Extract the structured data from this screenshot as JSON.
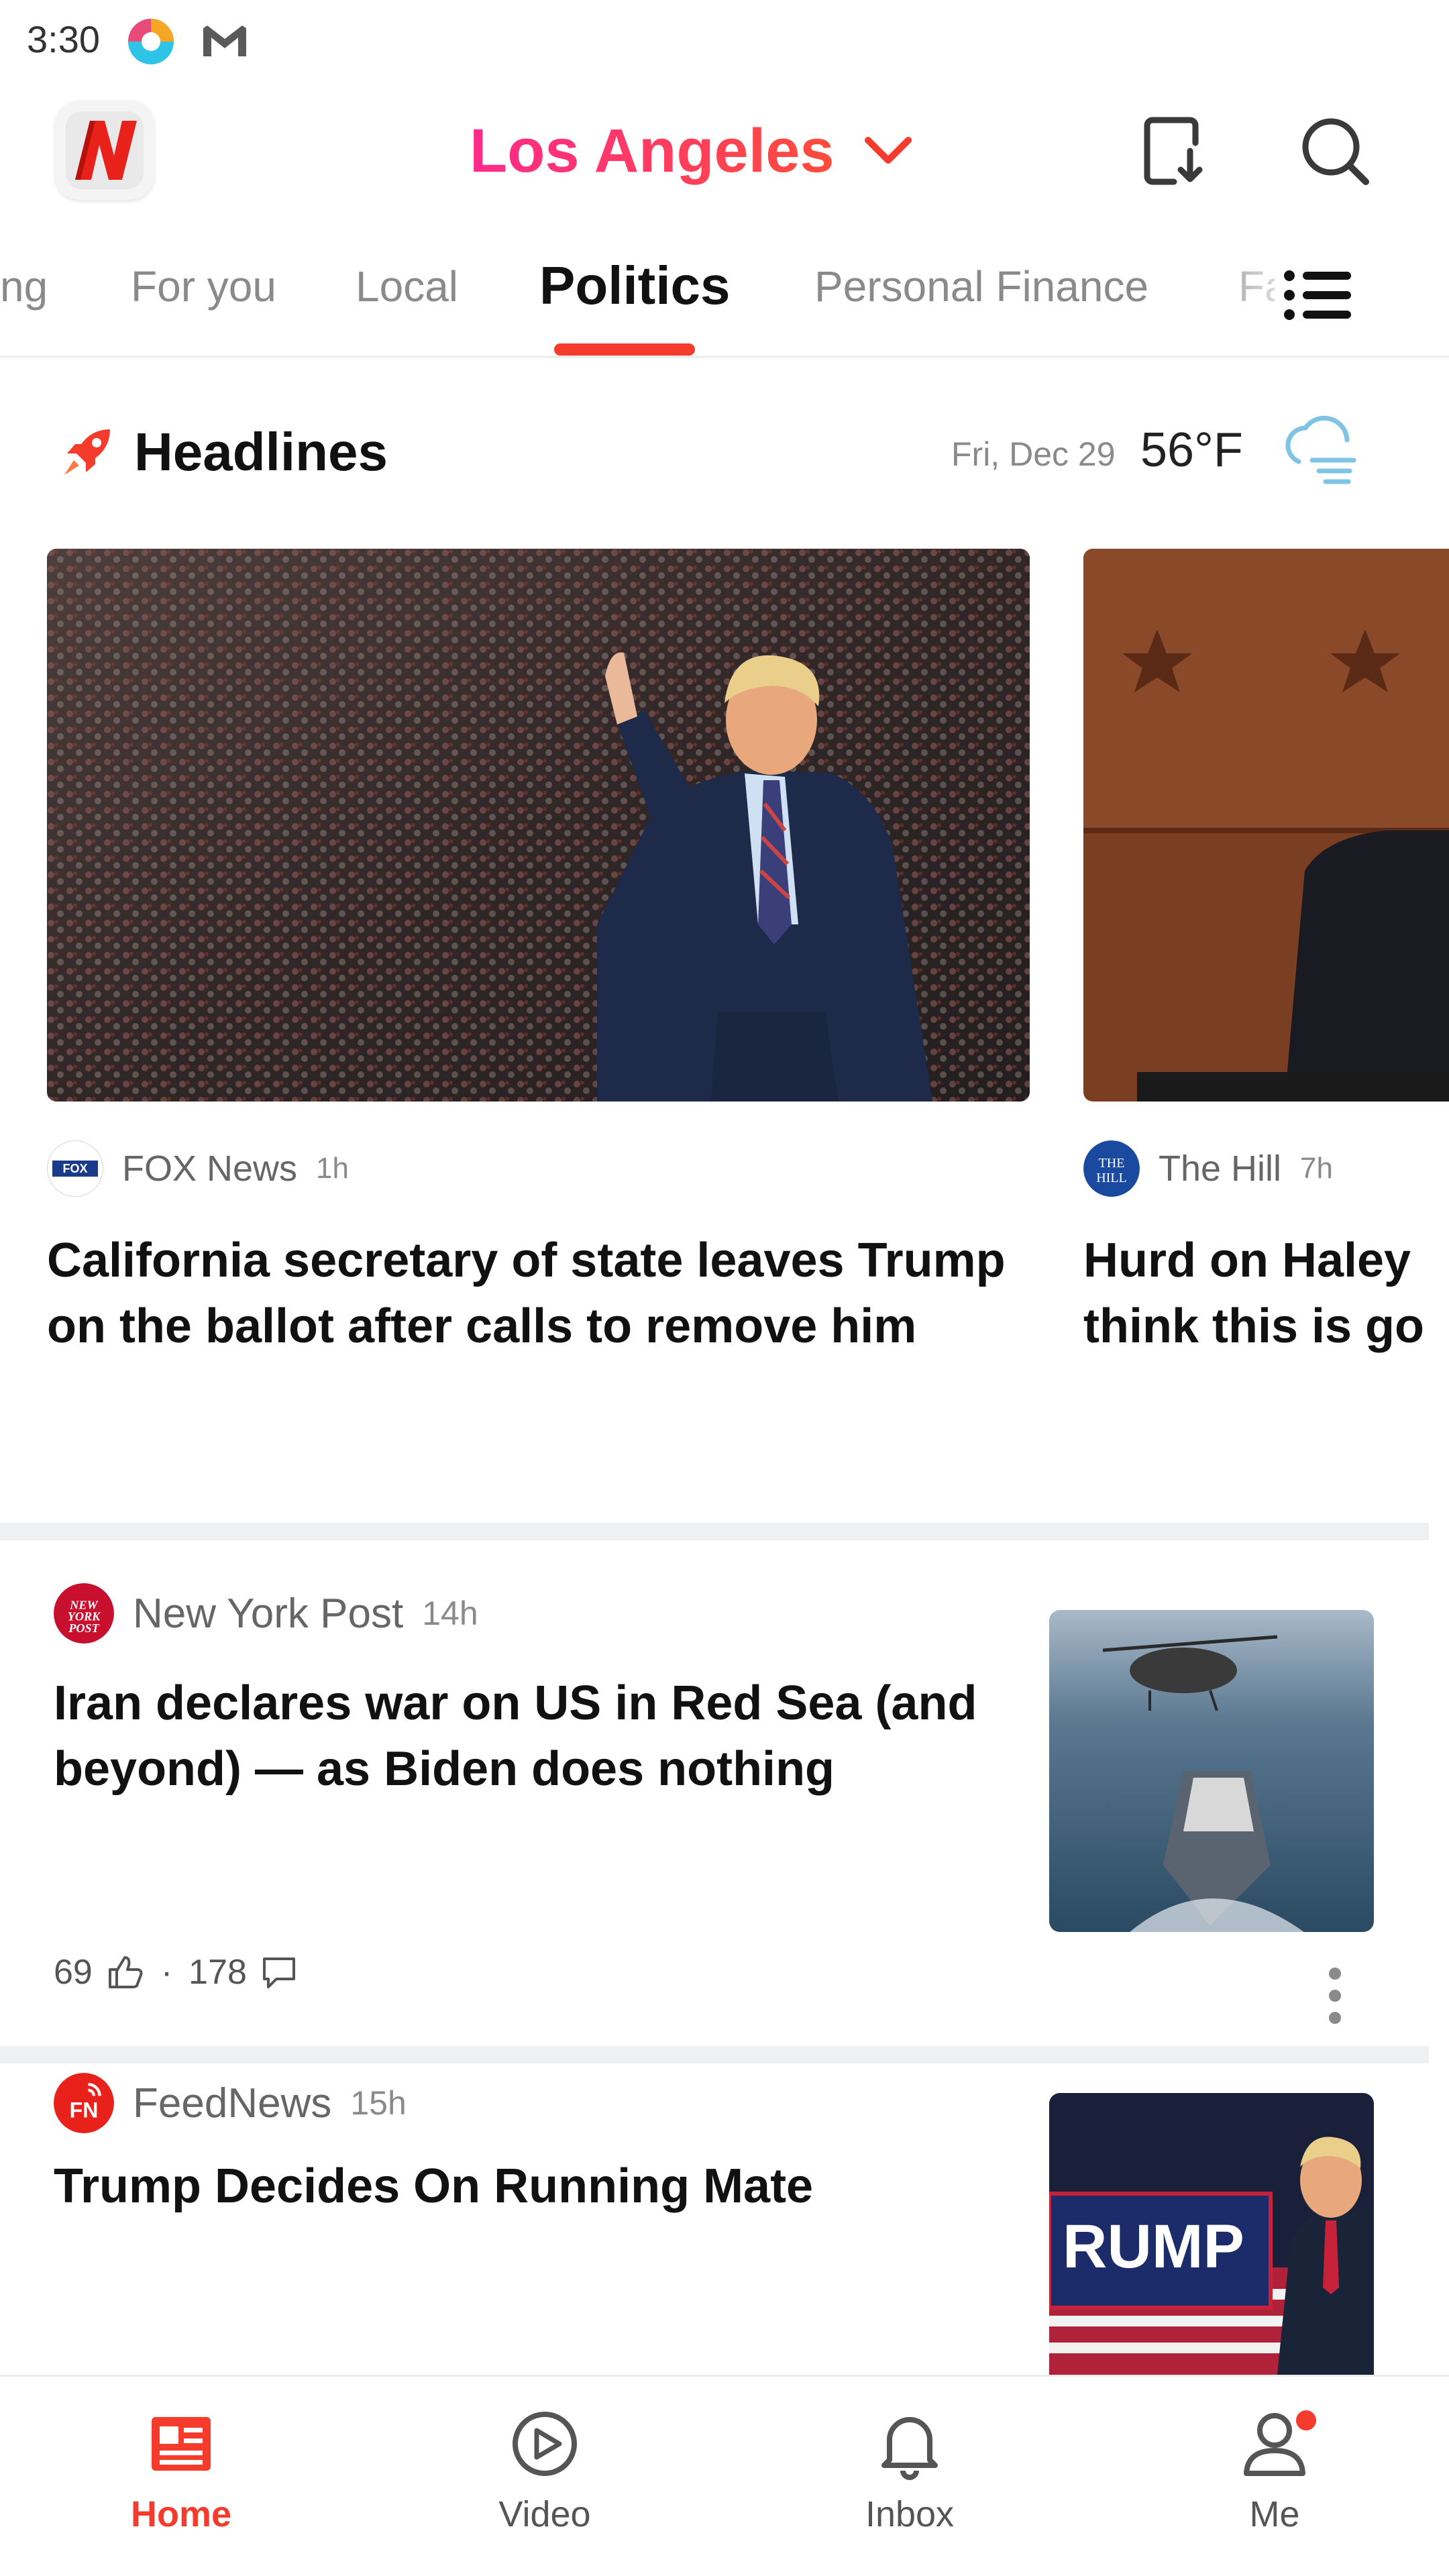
{
  "status_bar": {
    "time": "3:30",
    "icons": [
      "browser-app-icon",
      "gmail-icon"
    ]
  },
  "header": {
    "logo": "news-break-logo",
    "city": "Los Angeles",
    "city_dropdown_icon": "chevron-down-icon",
    "actions": [
      "download-icon",
      "search-icon"
    ],
    "accent_color": "#f43b2c",
    "city_gradient": [
      "#ff2a8a",
      "#ff4d3a"
    ]
  },
  "tabs": {
    "items": [
      {
        "label": "ng"
      },
      {
        "label": "For you"
      },
      {
        "label": "Local"
      },
      {
        "label": "Politics",
        "active": true
      },
      {
        "label": "Personal Finance"
      },
      {
        "label": "Fa"
      }
    ],
    "menu_icon": "list-menu-icon"
  },
  "headlines": {
    "title": "Headlines",
    "icon": "rocket-icon",
    "date": "Fri, Dec 29",
    "temperature": "56°F",
    "weather_icon": "cloudy-fog-icon",
    "cards": [
      {
        "source": "FOX News",
        "time": "1h",
        "title": "California secretary of state leaves Trump on the ballot after calls to remove him",
        "image": "photo-trump-waving-stadium"
      },
      {
        "source": "The Hill",
        "time": "7h",
        "title_lines": [
          "Hurd on Haley",
          "think this is go"
        ],
        "image": "photo-hearing-room"
      }
    ]
  },
  "feed": [
    {
      "source": "New York Post",
      "time": "14h",
      "title": "Iran declares war on US in Red Sea (and beyond) — as Biden does nothing",
      "likes": "69",
      "separator": "·",
      "comments": "178",
      "thumbnail": "photo-helicopter-ship"
    },
    {
      "source": "FeedNews",
      "time": "15h",
      "title": "Trump Decides On Running Mate",
      "thumbnail": "photo-trump-rally"
    }
  ],
  "bottom_nav": {
    "items": [
      {
        "label": "Home",
        "icon": "home-news-icon",
        "active": true
      },
      {
        "label": "Video",
        "icon": "play-circle-icon"
      },
      {
        "label": "Inbox",
        "icon": "bell-icon"
      },
      {
        "label": "Me",
        "icon": "person-icon",
        "badge": true
      }
    ]
  }
}
